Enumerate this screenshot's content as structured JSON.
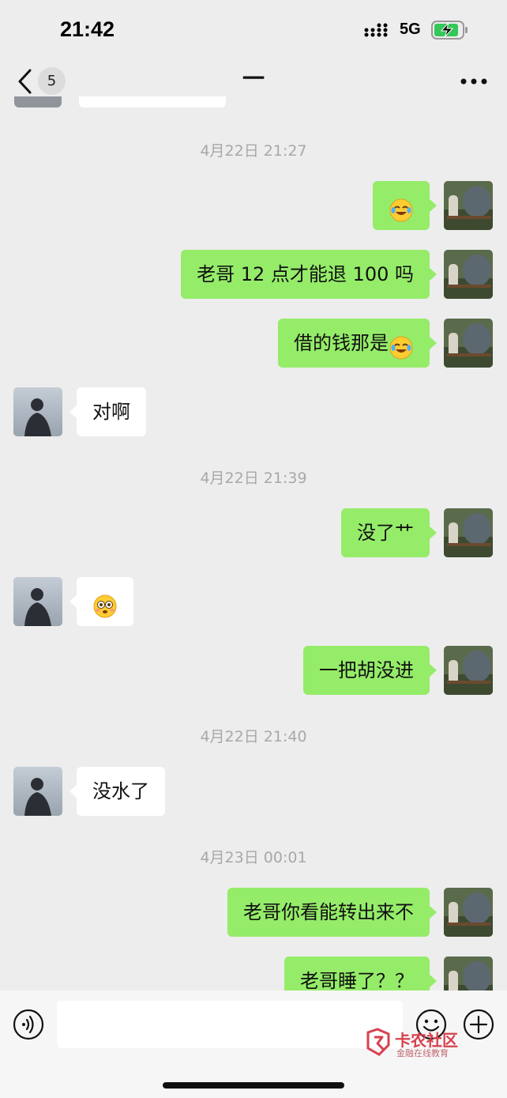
{
  "status_bar": {
    "time": "21:42",
    "network": "5G",
    "battery_charging": true
  },
  "nav": {
    "unread_count": "5",
    "title": "一"
  },
  "messages": [
    {
      "type": "timestamp",
      "text": "4月22日 21:27"
    },
    {
      "type": "message",
      "side": "mine",
      "text": "",
      "emoji": "rofl"
    },
    {
      "type": "message",
      "side": "mine",
      "text": "老哥 12 点才能退 100 吗"
    },
    {
      "type": "message",
      "side": "mine",
      "text": "借的钱那是",
      "emoji": "rofl"
    },
    {
      "type": "message",
      "side": "other",
      "text": "对啊"
    },
    {
      "type": "timestamp",
      "text": "4月22日 21:39"
    },
    {
      "type": "message",
      "side": "mine",
      "text": "没了艹"
    },
    {
      "type": "message",
      "side": "other",
      "text": "",
      "emoji": "flushed"
    },
    {
      "type": "message",
      "side": "mine",
      "text": "一把胡没进"
    },
    {
      "type": "timestamp",
      "text": "4月22日 21:40"
    },
    {
      "type": "message",
      "side": "other",
      "text": "没水了"
    },
    {
      "type": "timestamp",
      "text": "4月23日 00:01"
    },
    {
      "type": "message",
      "side": "mine",
      "text": "老哥你看能转出来不"
    },
    {
      "type": "message",
      "side": "mine",
      "text": "老哥睡了？？"
    }
  ],
  "input": {
    "placeholder": ""
  },
  "watermark": {
    "title": "卡农社区",
    "subtitle": "金融在线教育"
  },
  "colors": {
    "mine_bubble": "#95ec69",
    "other_bubble": "#ffffff",
    "background": "#ededed",
    "timestamp": "#a8a8a8"
  },
  "icons": {
    "back": "chevron-left-icon",
    "more": "ellipsis-icon",
    "voice": "voice-icon",
    "emoji": "smiley-icon",
    "plus": "plus-icon"
  }
}
